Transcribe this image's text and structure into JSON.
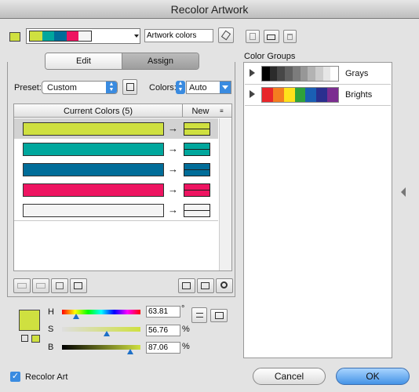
{
  "window": {
    "title": "Recolor Artwork"
  },
  "top": {
    "artwork_name": "Artwork colors",
    "current_swatches": [
      "#cfe040",
      "#00a79d",
      "#006d99",
      "#ee1461",
      "#f4f4f4"
    ],
    "active_color": "#cfe040"
  },
  "tabs": [
    {
      "label": "Edit"
    },
    {
      "label": "Assign"
    }
  ],
  "preset": {
    "label": "Preset:",
    "value": "Custom"
  },
  "colors": {
    "label": "Colors:",
    "value": "Auto"
  },
  "table": {
    "header_current": "Current Colors (5)",
    "header_new": "New",
    "rows": [
      {
        "current": "#cfe040",
        "new": "#cfe040",
        "selected": true
      },
      {
        "current": "#00a79d",
        "new": "#00a79d",
        "selected": false
      },
      {
        "current": "#006d99",
        "new": "#006d99",
        "selected": false
      },
      {
        "current": "#ee1461",
        "new": "#ee1461",
        "selected": false
      },
      {
        "current": "#f4f4f4",
        "new": "#f4f4f4",
        "selected": false
      }
    ]
  },
  "color_groups": {
    "label": "Color Groups",
    "groups": [
      {
        "name": "Grays",
        "swatches": [
          "#000000",
          "#2b2b2b",
          "#474747",
          "#616161",
          "#7c7c7c",
          "#979797",
          "#b3b3b3",
          "#cdcdcd",
          "#e6e6e6",
          "#ffffff"
        ]
      },
      {
        "name": "Brights",
        "swatches": [
          "#e8262a",
          "#f47d20",
          "#ffe11b",
          "#2fa23b",
          "#1a5fb4",
          "#2a2f8f",
          "#7b2d90"
        ]
      }
    ]
  },
  "hsb": {
    "h": {
      "label": "H",
      "value": "63.81",
      "unit": "°",
      "fraction": 0.1773
    },
    "s": {
      "label": "S",
      "value": "56.76",
      "unit": "%",
      "fraction": 0.5676
    },
    "b": {
      "label": "B",
      "value": "87.06",
      "unit": "%",
      "fraction": 0.8706
    }
  },
  "footer": {
    "recolor_art_label": "Recolor Art",
    "recolor_art_checked": true,
    "cancel_label": "Cancel",
    "ok_label": "OK"
  }
}
